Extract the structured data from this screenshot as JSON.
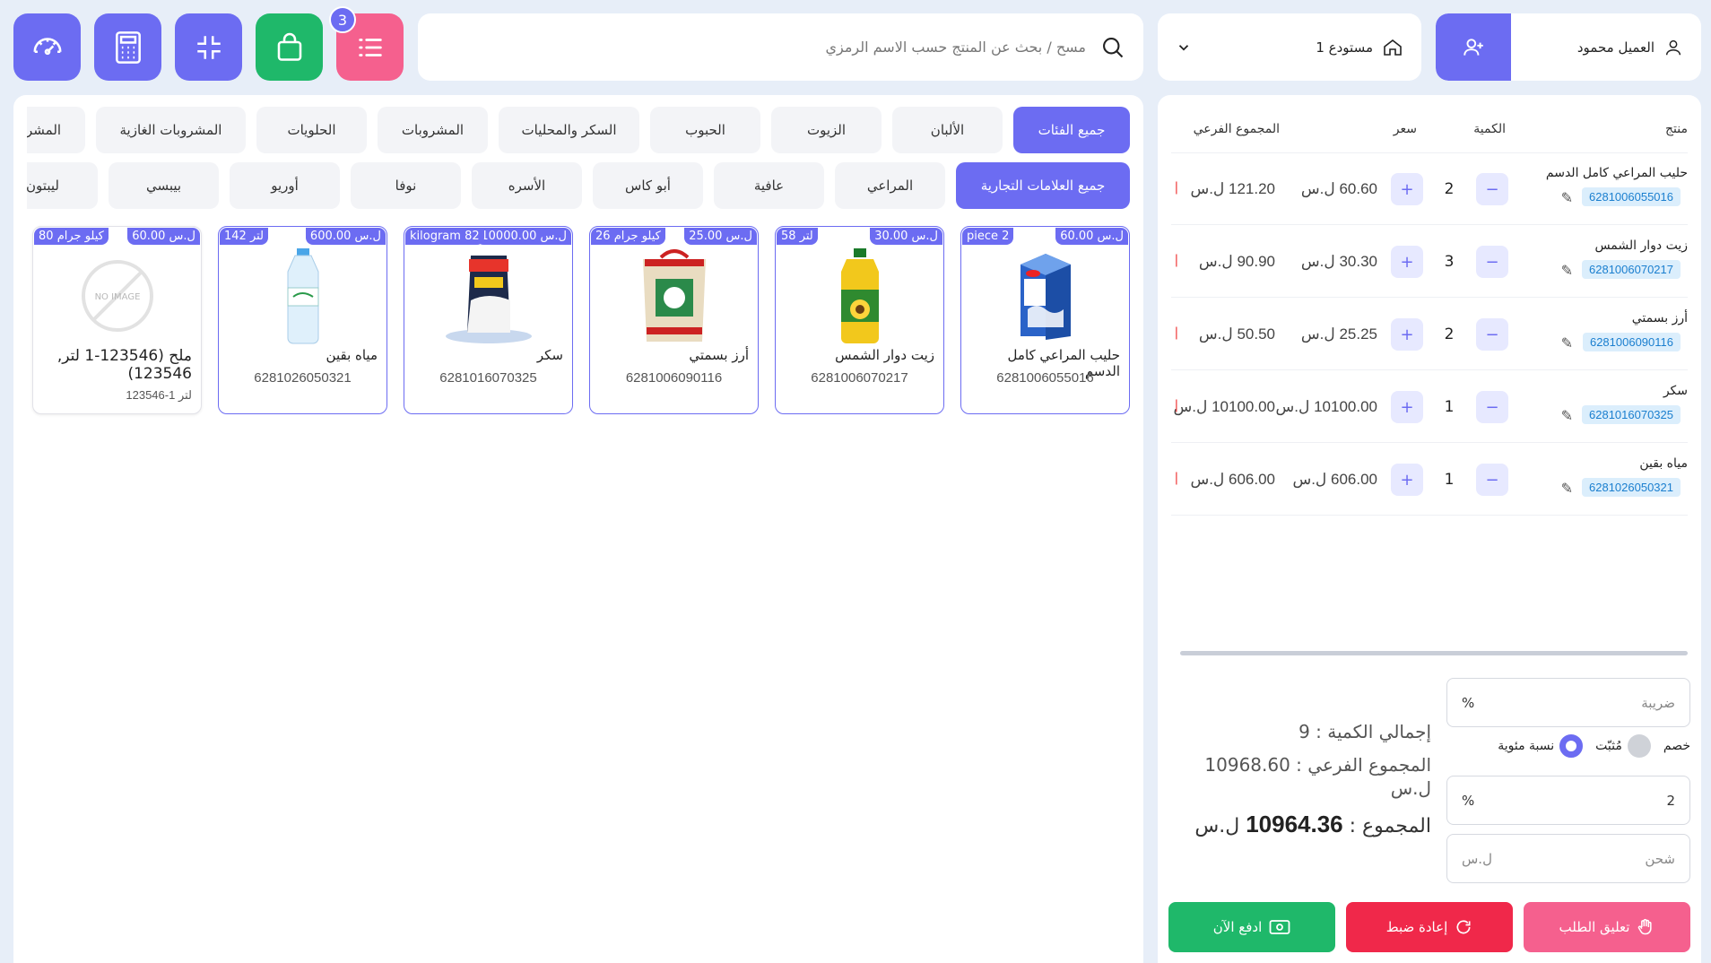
{
  "toolbar": {
    "dashboard_icon": "speedometer-icon",
    "calculator_icon": "calculator-icon",
    "fullscreen_icon": "collapse-icon",
    "orders_icon": "shopping-bag-icon",
    "list_icon": "list-icon",
    "list_badge": "3"
  },
  "search": {
    "placeholder": "مسح / بحث عن المنتج حسب الاسم الرمزي"
  },
  "warehouse": {
    "label": "مستودع 1"
  },
  "customer": {
    "label": "العميل محمود"
  },
  "categories": [
    "جميع الفئات",
    "الألبان",
    "الزيوت",
    "الحبوب",
    "السكر والمحليات",
    "المشروبات",
    "الحلويات",
    "المشروبات الغازية",
    "المشروبات"
  ],
  "brands": [
    "جميع العلامات التجارية",
    "المراعي",
    "عافية",
    "أبو كاس",
    "الأسره",
    "نوفا",
    "أوريو",
    "بيبسي",
    "ليبتون"
  ],
  "products": [
    {
      "name": "حليب المراعي كامل الدسم",
      "code": "6281006055016",
      "price": "60.00 ل.س",
      "stock": "piece 2"
    },
    {
      "name": "زيت دوار الشمس",
      "code": "6281006070217",
      "price": "30.00 ل.س",
      "stock": "58 لتر"
    },
    {
      "name": "أرز بسمتي",
      "code": "6281006090116",
      "price": "25.00 ل.س",
      "stock": "26 كيلو جرام"
    },
    {
      "name": "سكر",
      "code": "6281016070325",
      "price": "10000.00 ل.س",
      "stock": "kilogram 82"
    },
    {
      "name": "مياه بقين",
      "code": "6281026050321",
      "price": "600.00 ل.س",
      "stock": "142 لتر"
    },
    {
      "name": "ملح (123546-1 لتر, 123546)",
      "code": "123546-1 لتر",
      "price": "60.00 ل.س",
      "stock": "80 كيلو جرام",
      "image_text": "NO IMAGE"
    }
  ],
  "cart": {
    "headers": {
      "product": "منتج",
      "qty": "الكمية",
      "price": "سعر",
      "subtotal": "المجموع الفرعي"
    },
    "rows": [
      {
        "name": "حليب المراعي كامل الدسم",
        "code": "6281006055016",
        "qty": "2",
        "price": "60.60 ل.س",
        "subtotal": "121.20 ل.س"
      },
      {
        "name": "زيت دوار الشمس",
        "code": "6281006070217",
        "qty": "3",
        "price": "30.30 ل.س",
        "subtotal": "90.90 ل.س"
      },
      {
        "name": "أرز بسمتي",
        "code": "6281006090116",
        "qty": "2",
        "price": "25.25 ل.س",
        "subtotal": "50.50 ل.س"
      },
      {
        "name": "سكر",
        "code": "6281016070325",
        "qty": "1",
        "price": "10100.00 ل.س",
        "subtotal": "10100.00 ل.س"
      },
      {
        "name": "مياه بقين",
        "code": "6281026050321",
        "qty": "1",
        "price": "606.00 ل.س",
        "subtotal": "606.00 ل.س"
      }
    ]
  },
  "summary": {
    "tax_placeholder": "ضريبة",
    "tax_unit": "%",
    "discount_label": "خصم",
    "fixed_label": "مُثبّت",
    "percent_label": "نسبة مئوية",
    "discount_value": "2",
    "discount_unit": "%",
    "shipping_placeholder": "شحن",
    "shipping_unit": "ل.س",
    "total_qty": "إجمالي الكمية : 9",
    "subtotal": "المجموع الفرعي : 10968.60 ل.س",
    "total_label": "المجموع :",
    "total_value": "10964.36",
    "total_currency": "ل.س"
  },
  "actions": {
    "hold": "تعليق الطلب",
    "reset": "إعادة ضبط",
    "pay": "ادفع الآن"
  },
  "colors": {
    "accent": "#6c6cf2",
    "green": "#1fb86a",
    "pink": "#f5608e",
    "red": "#f0284a"
  }
}
